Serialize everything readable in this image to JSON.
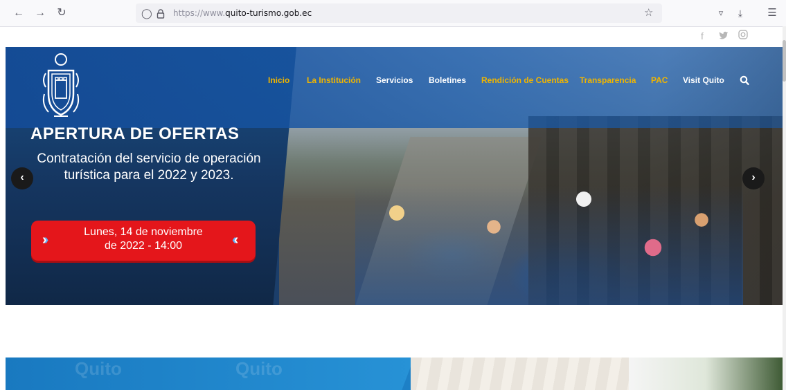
{
  "browser": {
    "url_prefix": "https://www.",
    "url_domain": "quito-turismo.gob.ec"
  },
  "nav": {
    "items": [
      {
        "label": "Inicio",
        "color": "#f0b500"
      },
      {
        "label": "La Institución",
        "color": "#f0b500"
      },
      {
        "label": "Servicios",
        "color": "#ffffff"
      },
      {
        "label": "Boletines",
        "color": "#ffffff"
      },
      {
        "label": "Rendición de Cuentas",
        "color": "#f0b500"
      },
      {
        "label": "Transparencia",
        "color": "#f0b500"
      },
      {
        "label": "PAC",
        "color": "#f0b500"
      },
      {
        "label": "Visit Quito",
        "color": "#ffffff"
      }
    ]
  },
  "hero": {
    "title": "APERTURA DE OFERTAS",
    "subtitle": "Contratación del servicio de operación turística para el 2022 y 2023.",
    "date_line1": "Lunes, 14 de noviembre",
    "date_line2": "de 2022 - 14:00"
  },
  "banner2": {
    "watermark1": "Quito",
    "watermark2": "Quito"
  },
  "colors": {
    "accent_gold": "#f0b500",
    "hero_blue": "#15355f",
    "date_red": "#e4161b"
  },
  "icons": {
    "back": "back-arrow-icon",
    "forward": "forward-arrow-icon",
    "reload": "reload-icon",
    "shield": "tracking-shield-icon",
    "lock": "lock-icon",
    "star": "bookmark-star-icon",
    "pocket": "pocket-icon",
    "download": "download-icon",
    "menu": "hamburger-menu-icon",
    "facebook": "facebook-icon",
    "twitter": "twitter-icon",
    "instagram": "instagram-icon",
    "search": "search-icon",
    "prev": "carousel-prev-icon",
    "next": "carousel-next-icon"
  }
}
